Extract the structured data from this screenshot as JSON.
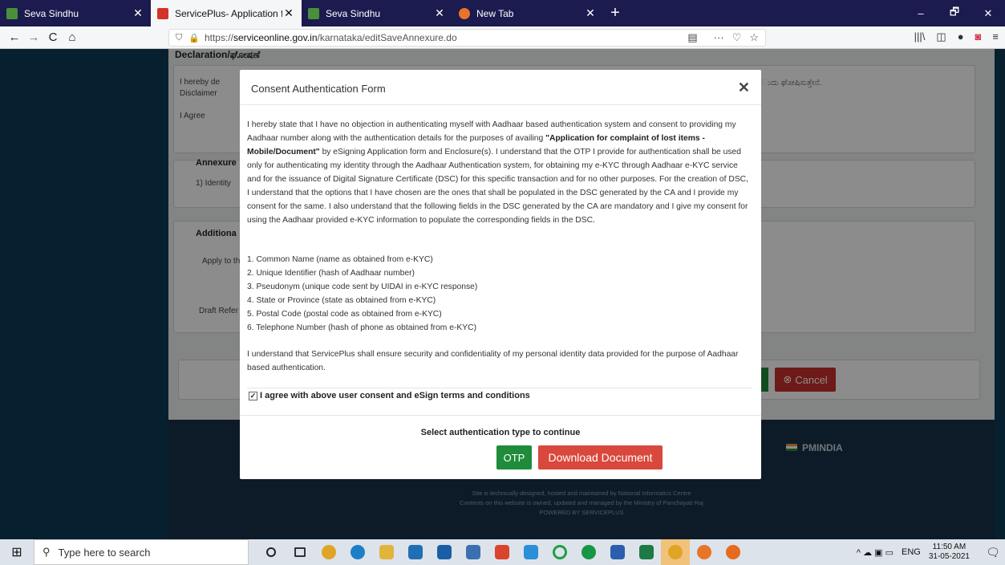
{
  "browser": {
    "tabs": [
      {
        "title": "Seva Sindhu",
        "favicon_color": "#4a8f3a",
        "active": false
      },
      {
        "title": "ServicePlus- Application for co",
        "favicon_color": "#d4332a",
        "active": true
      },
      {
        "title": "Seva Sindhu",
        "favicon_color": "#4a8f3a",
        "active": false
      },
      {
        "title": "New Tab",
        "favicon_color": "#e8742a",
        "active": false
      }
    ],
    "tab_close": "✕",
    "new_tab": "+",
    "win_controls": {
      "minimize": "–",
      "restore": "🗗",
      "close": "✕"
    },
    "nav": {
      "back": "←",
      "forward": "→",
      "reload": "C",
      "home": "⌂"
    },
    "url_prefix": "https://",
    "url_host": "serviceonline.gov.in",
    "url_path": "/karnataka/editSaveAnnexure.do",
    "url_icons": {
      "reader": "▤",
      "more": "···",
      "pocket": "♡",
      "bookmark": "☆"
    },
    "right_tools": {
      "library": "|||\\",
      "sidebar": "◫",
      "account": "●",
      "pocket": "◙",
      "menu": "≡"
    }
  },
  "background_page": {
    "declaration_heading": "Declaration/ಘೋಷಣೆ",
    "declaration_line1": "I hereby de",
    "declaration_line2": "Disclaimer",
    "kannada_fragment": "ುದು ಘೋಷಿಸುತ್ತೇನೆ.",
    "agree_label": "I Agree",
    "annexure_heading": "Annexure",
    "annexure_item": "1)   Identity",
    "additional_heading": "Additiona",
    "apply_to": "Apply to the",
    "draft_ref": "Draft Refer",
    "cancel_button": "Cancel",
    "cancel_icon": "⊗",
    "pmindia": "PMINDIA",
    "footer_line1": "Site is technically designed, hosted and maintained by National Informatics Centre",
    "footer_line2": "Contents on this website is owned, updated and managed by the Ministry of Panchayati Raj",
    "footer_line3": "POWERED BY SERVICEPLUS"
  },
  "modal": {
    "title": "Consent Authentication Form",
    "close": "✕",
    "consent_part1": "I hereby state that I have no objection in authenticating myself with Aadhaar based authentication system and consent to providing my Aadhaar number along with the authentication details for the purposes of availing ",
    "consent_bold": "\"Application for complaint of lost items - Mobile/Document\"",
    "consent_part2": " by eSigning Application form and Enclosure(s). I understand that the OTP I provide for authentication shall be used only for authenticating my identity through the Aadhaar Authentication system, for obtaining my e-KYC through Aadhaar e-KYC service and for the issuance of Digital Signature Certificate (DSC) for this specific transaction and for no other purposes. For the creation of DSC, I understand that the options that I have chosen are the ones that shall be populated in the DSC generated by the CA and I provide my consent for the same. I also understand that the following fields in the DSC generated by the CA are mandatory and I give my consent for using the Aadhaar provided e-KYC information to populate the corresponding fields in the DSC.",
    "fields": [
      "1. Common Name (name as obtained from e-KYC)",
      "2. Unique Identifier (hash of Aadhaar number)",
      "3. Pseudonym (unique code sent by UIDAI in e-KYC response)",
      "4. State or Province (state as obtained from e-KYC)",
      "5. Postal Code (postal code as obtained from e-KYC)",
      "6. Telephone Number (hash of phone as obtained from e-KYC)"
    ],
    "assurance": "I understand that ServicePlus shall ensure security and confidentiality of my personal identity data provided for the purpose of Aadhaar based authentication.",
    "agree_checkbox_checked": true,
    "agree_check_glyph": "✓",
    "agree_label": "I agree with above user consent and eSign terms and conditions",
    "select_auth": "Select authentication type to continue",
    "otp_button": "OTP",
    "download_button": "Download Document"
  },
  "taskbar": {
    "start_icon": "⊞",
    "search_icon": "⚲",
    "search_placeholder": "Type here to search",
    "apps": [
      {
        "name": "cortana-icon",
        "color": "#222222"
      },
      {
        "name": "task-view-icon",
        "color": "#333333"
      },
      {
        "name": "chrome-icon",
        "color": "#e0a526"
      },
      {
        "name": "edge-icon",
        "color": "#1e7fc9"
      },
      {
        "name": "file-explorer-icon",
        "color": "#e2b43c"
      },
      {
        "name": "mail-icon",
        "color": "#1f6fb5"
      },
      {
        "name": "store-icon",
        "color": "#1a5ea8"
      },
      {
        "name": "photos-icon",
        "color": "#3b6fb0"
      },
      {
        "name": "office-icon",
        "color": "#d9442b"
      },
      {
        "name": "paint-icon",
        "color": "#2a8fd6"
      },
      {
        "name": "circle-app-icon",
        "color": "#1f9e4a"
      },
      {
        "name": "green-app-icon",
        "color": "#169745"
      },
      {
        "name": "word-icon",
        "color": "#2b5fad"
      },
      {
        "name": "excel-icon",
        "color": "#1d7a44"
      },
      {
        "name": "chrome2-icon",
        "color": "#e0a526"
      },
      {
        "name": "orange-app-icon",
        "color": "#e8742a"
      },
      {
        "name": "firefox-icon",
        "color": "#e66a1f"
      }
    ],
    "tray_icons": "^ ☁ ▣ ▭",
    "language": "ENG",
    "time": "11:50 AM",
    "date": "31-05-2021",
    "notification_icon": "🗨"
  }
}
